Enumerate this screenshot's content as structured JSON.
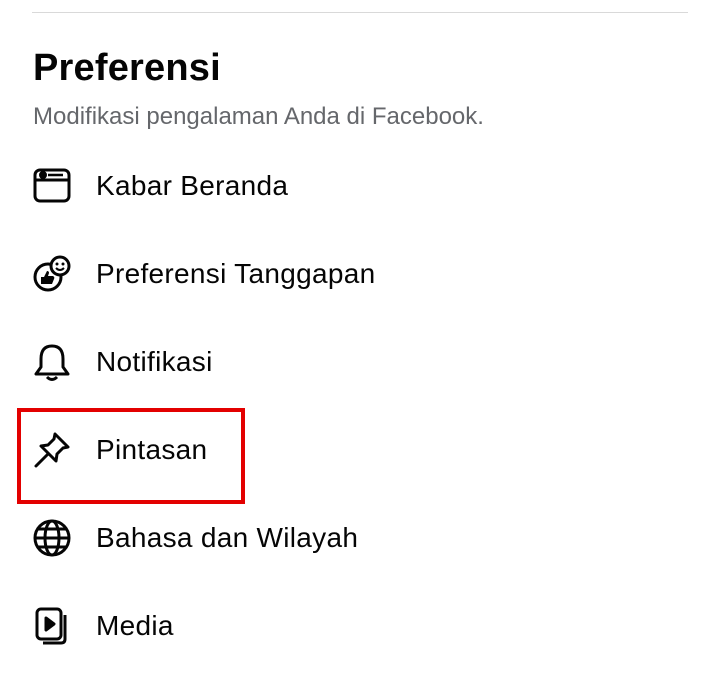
{
  "section": {
    "title": "Preferensi",
    "subtitle": "Modifikasi pengalaman Anda di Facebook."
  },
  "menu": {
    "items": [
      {
        "label": "Kabar Beranda",
        "icon": "news-feed-icon"
      },
      {
        "label": "Preferensi Tanggapan",
        "icon": "reaction-preferences-icon"
      },
      {
        "label": "Notifikasi",
        "icon": "bell-icon"
      },
      {
        "label": "Pintasan",
        "icon": "pin-icon"
      },
      {
        "label": "Bahasa dan Wilayah",
        "icon": "globe-icon"
      },
      {
        "label": "Media",
        "icon": "media-icon"
      }
    ]
  },
  "highlight": {
    "color": "#e30000",
    "target": "Pintasan"
  },
  "colors": {
    "text_primary": "#050505",
    "text_secondary": "#65676b",
    "divider": "#d9d9d9"
  }
}
